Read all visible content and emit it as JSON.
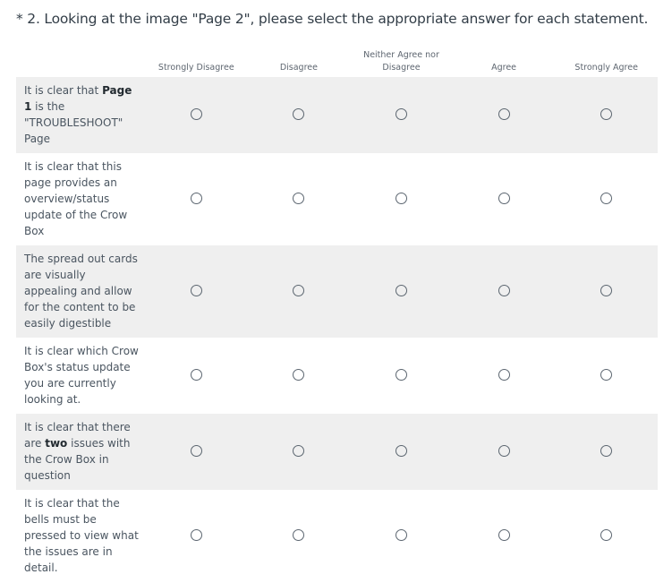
{
  "question": {
    "required_marker": "*",
    "text": " 2. Looking at the image \"Page 2\", please select the appropriate answer for each statement."
  },
  "columns": [
    "Strongly Disagree",
    "Disagree",
    "Neither Agree nor Disagree",
    "Agree",
    "Strongly Agree"
  ],
  "rows": [
    {
      "parts": [
        {
          "t": "It is clear that "
        },
        {
          "t": "Page 1",
          "b": true
        },
        {
          "t": " is the \"TROUBLESHOOT\" Page"
        }
      ],
      "shaded": true,
      "height": 85
    },
    {
      "parts": [
        {
          "t": "It is clear that this page provides an overview/status update of the Crow Box"
        }
      ],
      "shaded": false,
      "height": 101
    },
    {
      "parts": [
        {
          "t": "The spread out cards are visually appealing and allow for the content to be easily digestible"
        }
      ],
      "shaded": true,
      "height": 101
    },
    {
      "parts": [
        {
          "t": "It is clear which Crow Box's status update you are currently looking at."
        }
      ],
      "shaded": false,
      "height": 83
    },
    {
      "parts": [
        {
          "t": "It is clear that there are "
        },
        {
          "t": "two",
          "b": true
        },
        {
          "t": " issues with the Crow Box in question"
        }
      ],
      "shaded": true,
      "height": 84
    },
    {
      "parts": [
        {
          "t": "It is clear that the bells must be pressed to view what the issues are in detail."
        }
      ],
      "shaded": false,
      "height": 101
    }
  ]
}
